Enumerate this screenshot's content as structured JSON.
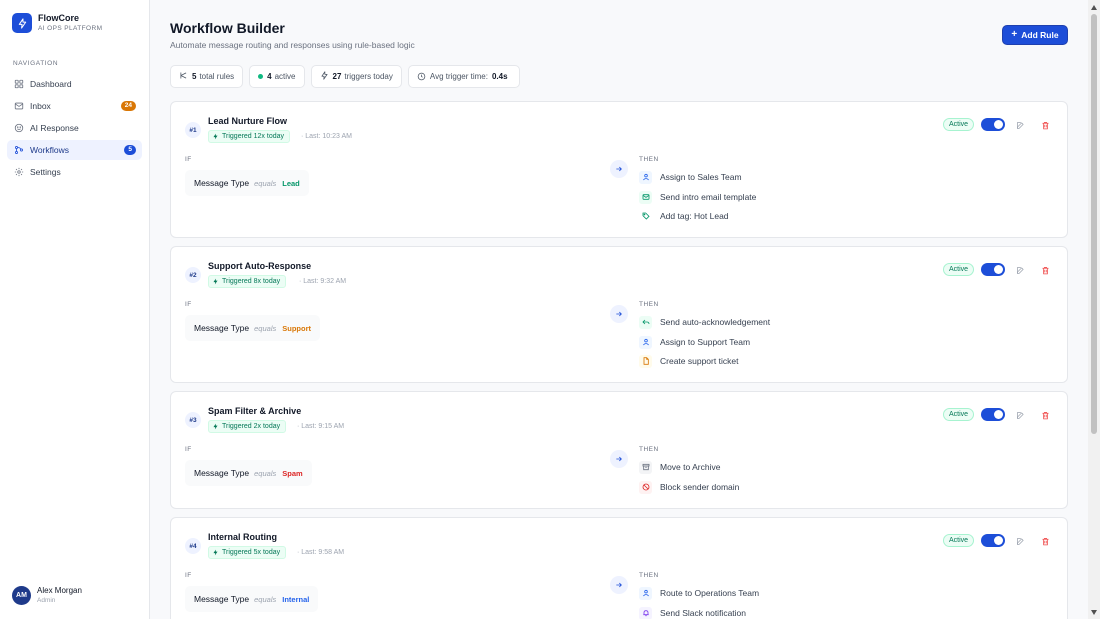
{
  "brand": {
    "name": "FlowCore",
    "subtitle": "AI OPS PLATFORM"
  },
  "sidebar": {
    "heading": "NAVIGATION",
    "items": [
      {
        "label": "Dashboard",
        "icon": "grid-icon"
      },
      {
        "label": "Inbox",
        "icon": "mail-icon",
        "badge": "24",
        "badge_color": "#d97706"
      },
      {
        "label": "AI Response",
        "icon": "smile-icon"
      },
      {
        "label": "Workflows",
        "icon": "workflow-icon",
        "badge": "5",
        "badge_color": "#1d4ed8",
        "active": true
      },
      {
        "label": "Settings",
        "icon": "gear-icon"
      }
    ]
  },
  "user": {
    "initials": "AM",
    "name": "Alex Morgan",
    "role": "Admin"
  },
  "header": {
    "title": "Workflow Builder",
    "subtitle": "Automate message routing and responses using rule-based logic",
    "add_label": "Add Rule"
  },
  "stats": {
    "total_value": "5",
    "total_label": "total rules",
    "active_value": "4",
    "active_label": "active",
    "triggers_value": "27",
    "triggers_label": "triggers today",
    "avg_label": "Avg trigger time:",
    "avg_value": "0.4s"
  },
  "labels": {
    "if": "IF",
    "then": "THEN",
    "active": "Active",
    "equals": "equals"
  },
  "rules": [
    {
      "num": "#1",
      "name": "Lead Nurture Flow",
      "triggered": "Triggered 12x today",
      "last": "· Last: 10:23 AM",
      "field": "Message Type",
      "value": "Lead",
      "value_color": "#059669",
      "actions": [
        {
          "label": "Assign to Sales Team",
          "icon": "user-icon",
          "color": "#2563eb",
          "bg": "#eff6ff"
        },
        {
          "label": "Send intro email template",
          "icon": "mail-icon",
          "color": "#059669",
          "bg": "#ecfdf5"
        },
        {
          "label": "Add tag: Hot Lead",
          "icon": "tag-icon",
          "color": "#059669",
          "bg": "#ffffff"
        }
      ]
    },
    {
      "num": "#2",
      "name": "Support Auto-Response",
      "triggered": "Triggered 8x today",
      "last": "· Last: 9:32 AM",
      "field": "Message Type",
      "value": "Support",
      "value_color": "#d97706",
      "actions": [
        {
          "label": "Send auto-acknowledgement",
          "icon": "reply-icon",
          "color": "#059669",
          "bg": "#ecfdf5"
        },
        {
          "label": "Assign to Support Team",
          "icon": "user-icon",
          "color": "#2563eb",
          "bg": "#eff6ff"
        },
        {
          "label": "Create support ticket",
          "icon": "file-icon",
          "color": "#d97706",
          "bg": "#fffbeb"
        }
      ]
    },
    {
      "num": "#3",
      "name": "Spam Filter & Archive",
      "triggered": "Triggered 2x today",
      "last": "· Last: 9:15 AM",
      "field": "Message Type",
      "value": "Spam",
      "value_color": "#dc2626",
      "actions": [
        {
          "label": "Move to Archive",
          "icon": "archive-icon",
          "color": "#6b7280",
          "bg": "#f3f4f6"
        },
        {
          "label": "Block sender domain",
          "icon": "block-icon",
          "color": "#dc2626",
          "bg": "#fef2f2"
        }
      ]
    },
    {
      "num": "#4",
      "name": "Internal Routing",
      "triggered": "Triggered 5x today",
      "last": "· Last: 9:58 AM",
      "field": "Message Type",
      "value": "Internal",
      "value_color": "#2563eb",
      "actions": [
        {
          "label": "Route to Operations Team",
          "icon": "user-icon",
          "color": "#2563eb",
          "bg": "#eff6ff"
        },
        {
          "label": "Send Slack notification",
          "icon": "bell-icon",
          "color": "#7c3aed",
          "bg": "#f5f3ff"
        }
      ]
    }
  ]
}
